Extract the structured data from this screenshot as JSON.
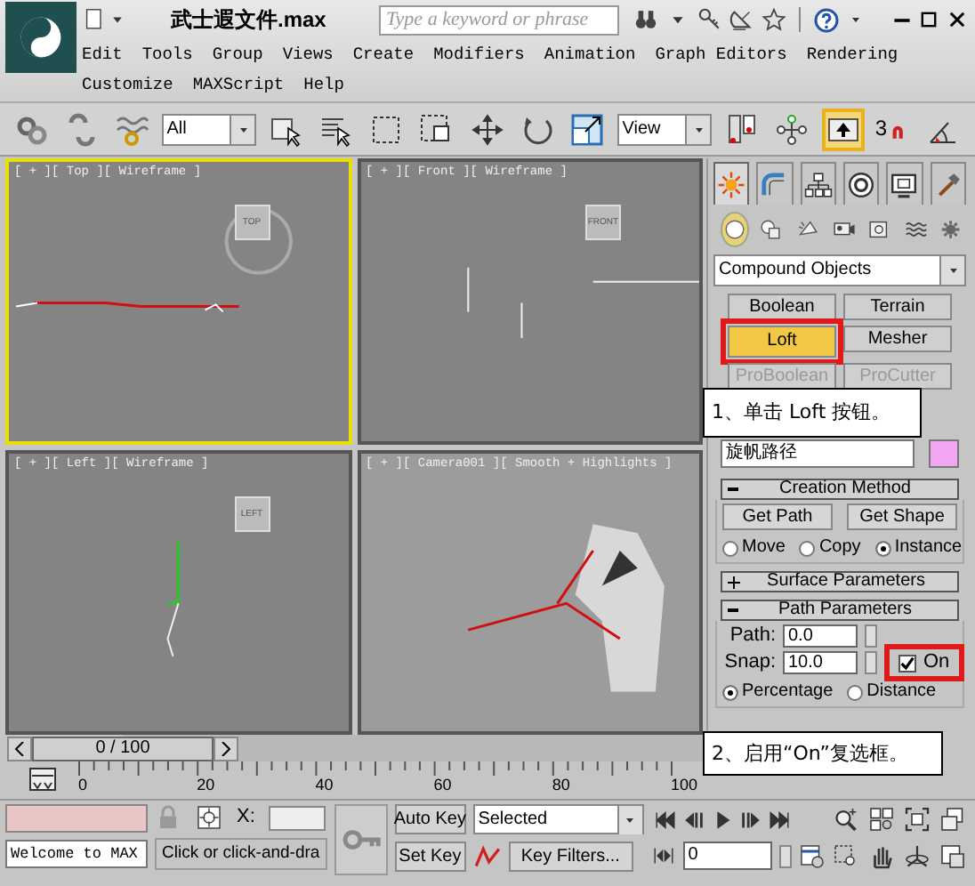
{
  "window": {
    "title": "武士遐文件.max",
    "search_placeholder": "Type a keyword or phrase"
  },
  "menu_rows": [
    {
      "items": [
        "Edit",
        "Tools",
        "Group",
        "Views",
        "Create",
        "Modifiers",
        "Animation",
        "Graph Editors",
        "Rendering"
      ]
    },
    {
      "items": [
        "Customize",
        "MAXScript",
        "Help"
      ]
    }
  ],
  "toolbar": [
    {
      "kind": "link",
      "selected": false
    },
    {
      "kind": "unlink",
      "selected": false
    },
    {
      "kind": "wave",
      "selected": false
    },
    {
      "kind": "dropdown",
      "value": "All"
    },
    {
      "kind": "cube-cursor",
      "selected": false
    },
    {
      "kind": "list-cursor",
      "selected": false
    },
    {
      "kind": "dashed-rect",
      "selected": false
    },
    {
      "kind": "dashed-cube",
      "selected": false
    },
    {
      "kind": "move",
      "selected": false
    },
    {
      "kind": "rotate",
      "selected": false
    },
    {
      "kind": "scale",
      "selected": false
    },
    {
      "kind": "dropdown",
      "value": "View"
    },
    {
      "kind": "pivot",
      "selected": false
    },
    {
      "kind": "nodes",
      "selected": false
    },
    {
      "kind": "up-arrow",
      "selected": true
    },
    {
      "kind": "magnet",
      "value": "3",
      "selected": false
    },
    {
      "kind": "angle",
      "selected": false
    }
  ],
  "viewports": [
    {
      "label": "[ + ][ Top ][ Wireframe ]",
      "active": true,
      "kind": "top",
      "viewcube": "TOP"
    },
    {
      "label": "[ + ][ Front ][ Wireframe ]",
      "active": false,
      "kind": "front",
      "viewcube": "FRONT"
    },
    {
      "label": "[ + ][ Left ][ Wireframe ]",
      "active": false,
      "kind": "left",
      "viewcube": "LEFT"
    },
    {
      "label": "[ + ][ Camera001 ][ Smooth + Highlights ]",
      "active": false,
      "kind": "camera"
    }
  ],
  "command_panel": {
    "tabs": [
      {
        "kind": "sun",
        "selected": true
      },
      {
        "kind": "arc",
        "selected": false
      },
      {
        "kind": "hierarchy",
        "selected": false
      },
      {
        "kind": "disc",
        "selected": false
      },
      {
        "kind": "monitor",
        "selected": false
      },
      {
        "kind": "hammer",
        "selected": false
      }
    ],
    "categories": [
      {
        "kind": "sphere",
        "selected": true
      },
      {
        "kind": "shapes",
        "selected": false
      },
      {
        "kind": "lamp",
        "selected": false
      },
      {
        "kind": "camera",
        "selected": false
      },
      {
        "kind": "helper",
        "selected": false
      },
      {
        "kind": "waves",
        "selected": false
      },
      {
        "kind": "gear",
        "selected": false
      }
    ],
    "category_dropdown": "Compound Objects",
    "object_types": [
      {
        "label": "Boolean",
        "selected": false,
        "disabled": false,
        "annotated": false
      },
      {
        "label": "Terrain",
        "selected": false,
        "disabled": false,
        "annotated": false
      },
      {
        "label": "Loft",
        "selected": true,
        "disabled": false,
        "annotated": true
      },
      {
        "label": "Mesher",
        "selected": false,
        "disabled": false,
        "annotated": false
      },
      {
        "label": "ProBoolean",
        "selected": false,
        "disabled": true,
        "annotated": false
      },
      {
        "label": "ProCutter",
        "selected": false,
        "disabled": true,
        "annotated": false
      }
    ],
    "object_name": "旋帆路径",
    "rollouts": [
      {
        "title": "Creation Method",
        "expanded": true,
        "buttons": [
          "Get Path",
          "Get Shape"
        ],
        "radios": [
          {
            "label": "Move",
            "selected": false
          },
          {
            "label": "Copy",
            "selected": false
          },
          {
            "label": "Instance",
            "selected": true
          }
        ]
      },
      {
        "title": "Surface Parameters",
        "expanded": false
      },
      {
        "title": "Path Parameters",
        "expanded": true,
        "fields": [
          {
            "label": "Path:",
            "value": "0.0"
          },
          {
            "label": "Snap:",
            "value": "10.0"
          }
        ],
        "checkbox": {
          "label": "On",
          "checked": true,
          "annotated": true
        },
        "radios": [
          {
            "label": "Percentage",
            "selected": true
          },
          {
            "label": "Distance",
            "selected": false
          }
        ]
      }
    ]
  },
  "callouts": [
    {
      "text": "1、单击 Loft 按钮。"
    },
    {
      "text": "2、启用“On”复选框。"
    }
  ],
  "time_slider": {
    "label": "0 / 100",
    "level": 0
  },
  "track_bar": {
    "ticks": [
      "0",
      "20",
      "40",
      "60",
      "80",
      "100"
    ]
  },
  "status": {
    "message": "Welcome to MAX",
    "prompt": "Click or click-and-dra",
    "x_label": "X:",
    "auto_key": "Auto Key",
    "set_key": "Set Key",
    "key_mode": "Selected",
    "key_filters": "Key Filters...",
    "frame": "0"
  }
}
